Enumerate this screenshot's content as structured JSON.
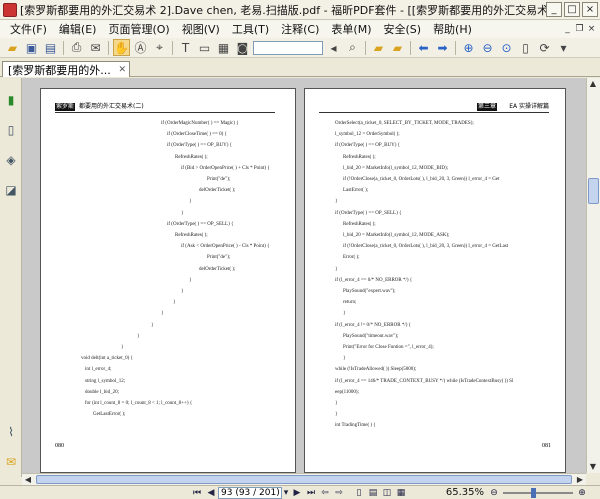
{
  "window": {
    "title": "[索罗斯都要用的外汇交易术  2].Dave chen, 老易.扫描版.pdf - 福昕PDF套件 - [[索罗斯都要用的外汇交易术  2]..."
  },
  "menu": [
    "文件(F)",
    "编辑(E)",
    "页面管理(O)",
    "视图(V)",
    "工具(T)",
    "注释(C)",
    "表单(M)",
    "安全(S)",
    "帮助(H)"
  ],
  "tab": {
    "label": "[索罗斯都要用的外..."
  },
  "left_page": {
    "header_tag": "索罗斯",
    "header_text": "都要用的外汇交易术(二)",
    "page_number": "080",
    "lines": [
      "if (OrderMagicNumber( ) == Magic) {",
      "if (OrderCloseTime( ) == 0) {",
      "if (OrderType( ) == OP_BUY) {",
      "RefreshRates( );",
      "if (Bid > OrderOpenPrice( ) + Cls * Point) {",
      "Print(\"de\");",
      "delOrderTicket( );",
      "}",
      "}",
      "if (OrderType( ) == OP_SELL) {",
      "RefreshRates( );",
      "if (Ask < OrderOpenPrice( ) - Cls * Point) {",
      "Print(\"de\");",
      "delOrderTicket( );",
      "}",
      "}",
      "}",
      "}",
      "}",
      "}",
      "}",
      "void delt(int a_ticket_0) {",
      "int l_error_4;",
      "string l_symbol_12;",
      "double l_bid_20;",
      "for (int l_count_8 = 0; l_count_8 < 1; l_count_8++) {",
      "GetLastError( );"
    ]
  },
  "right_page": {
    "header_tag": "第三章",
    "header_text": "EA 实操详解篇",
    "page_number": "081",
    "lines": [
      "OrderSelect(a_ticket_0, SELECT_BY_TICKET, MODE_TRADES);",
      "l_symbol_12 = OrderSymbol( );",
      "if (OrderType( ) == OP_BUY) {",
      "RefreshRates( );",
      "l_bid_20 = MarketInfo(l_symbol_12, MODE_BID);",
      "if (!OrderClose(a_ticket_0, OrderLots( ), l_bid_20, 3, Green)) l_error_4 = Get",
      "LastError( );",
      "}",
      "if (OrderType( ) == OP_SELL) {",
      "RefreshRates( );",
      "l_bid_20 = MarketInfo(l_symbol_12, MODE_ASK);",
      "if (!OrderClose(a_ticket_0, OrderLots( ), l_bid_20, 3, Green)) l_error_4 = GetLast",
      "Error( );",
      "}",
      "if (l_error_4 == 0/* NO_ERROR */) {",
      "PlaySound(\"expert.wav\");",
      "return;",
      "}",
      "if (l_error_4 != 0/* NO_ERROR */) {",
      "PlaySound(\"timeout.wav\");",
      "Print(\"Error for Close Funtion =\", l_error_4);",
      "}",
      "while (!IsTradeAllowed( )) Sleep(5000);",
      "if (l_error_4 == 146/* TRADE_CONTEXT_BUSY */) while (IsTradeContextBusy( )) Sl",
      "eep(11000);",
      "}",
      "}",
      "int TradingTime( ) {"
    ]
  },
  "status": {
    "page_input": "93 (93 / 201)",
    "zoom": "65.35%"
  }
}
